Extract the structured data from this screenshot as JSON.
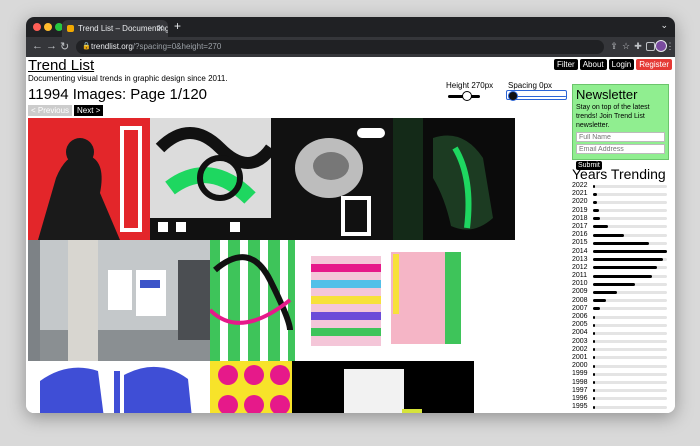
{
  "browser": {
    "tab_title": "Trend List – Documenting visu",
    "url_host": "trendlist.org",
    "url_rest": "/?spacing=0&height=270"
  },
  "site": {
    "title": "Trend List",
    "tagline": "Documenting visual trends in graphic design since 2011.",
    "buttons": [
      "Filter",
      "About",
      "Login",
      "Register"
    ]
  },
  "gallery": {
    "count_text": "11994 Images: Page 1/120",
    "prev_label": "< Previous",
    "next_label": "Next >",
    "height_label": "Height 270px",
    "spacing_label": "Spacing 0px",
    "height_value": 0.55,
    "spacing_value": 0.0
  },
  "newsletter": {
    "title": "Newsletter",
    "text": "Stay on top of the latest trends! Join Trend List newsletter.",
    "name_placeholder": "Full Name",
    "email_placeholder": "Email Address",
    "submit_label": "Submit"
  },
  "years": {
    "title": "Years Trending",
    "rows": [
      {
        "year": "2022",
        "value": 0.02
      },
      {
        "year": "2021",
        "value": 0.05
      },
      {
        "year": "2020",
        "value": 0.05
      },
      {
        "year": "2019",
        "value": 0.08
      },
      {
        "year": "2018",
        "value": 0.1
      },
      {
        "year": "2017",
        "value": 0.2
      },
      {
        "year": "2016",
        "value": 0.42
      },
      {
        "year": "2015",
        "value": 0.75
      },
      {
        "year": "2014",
        "value": 1.0
      },
      {
        "year": "2013",
        "value": 0.95
      },
      {
        "year": "2012",
        "value": 0.87
      },
      {
        "year": "2011",
        "value": 0.8
      },
      {
        "year": "2010",
        "value": 0.57
      },
      {
        "year": "2009",
        "value": 0.32
      },
      {
        "year": "2008",
        "value": 0.18
      },
      {
        "year": "2007",
        "value": 0.1
      },
      {
        "year": "2006",
        "value": 0.03
      },
      {
        "year": "2005",
        "value": 0.02
      },
      {
        "year": "2004",
        "value": 0.02
      },
      {
        "year": "2003",
        "value": 0.01
      },
      {
        "year": "2002",
        "value": 0.01
      },
      {
        "year": "2001",
        "value": 0.01
      },
      {
        "year": "2000",
        "value": 0.01
      },
      {
        "year": "1999",
        "value": 0.01
      },
      {
        "year": "1998",
        "value": 0.01
      },
      {
        "year": "1997",
        "value": 0.01
      },
      {
        "year": "1996",
        "value": 0.01
      },
      {
        "year": "1995",
        "value": 0.01
      }
    ]
  }
}
